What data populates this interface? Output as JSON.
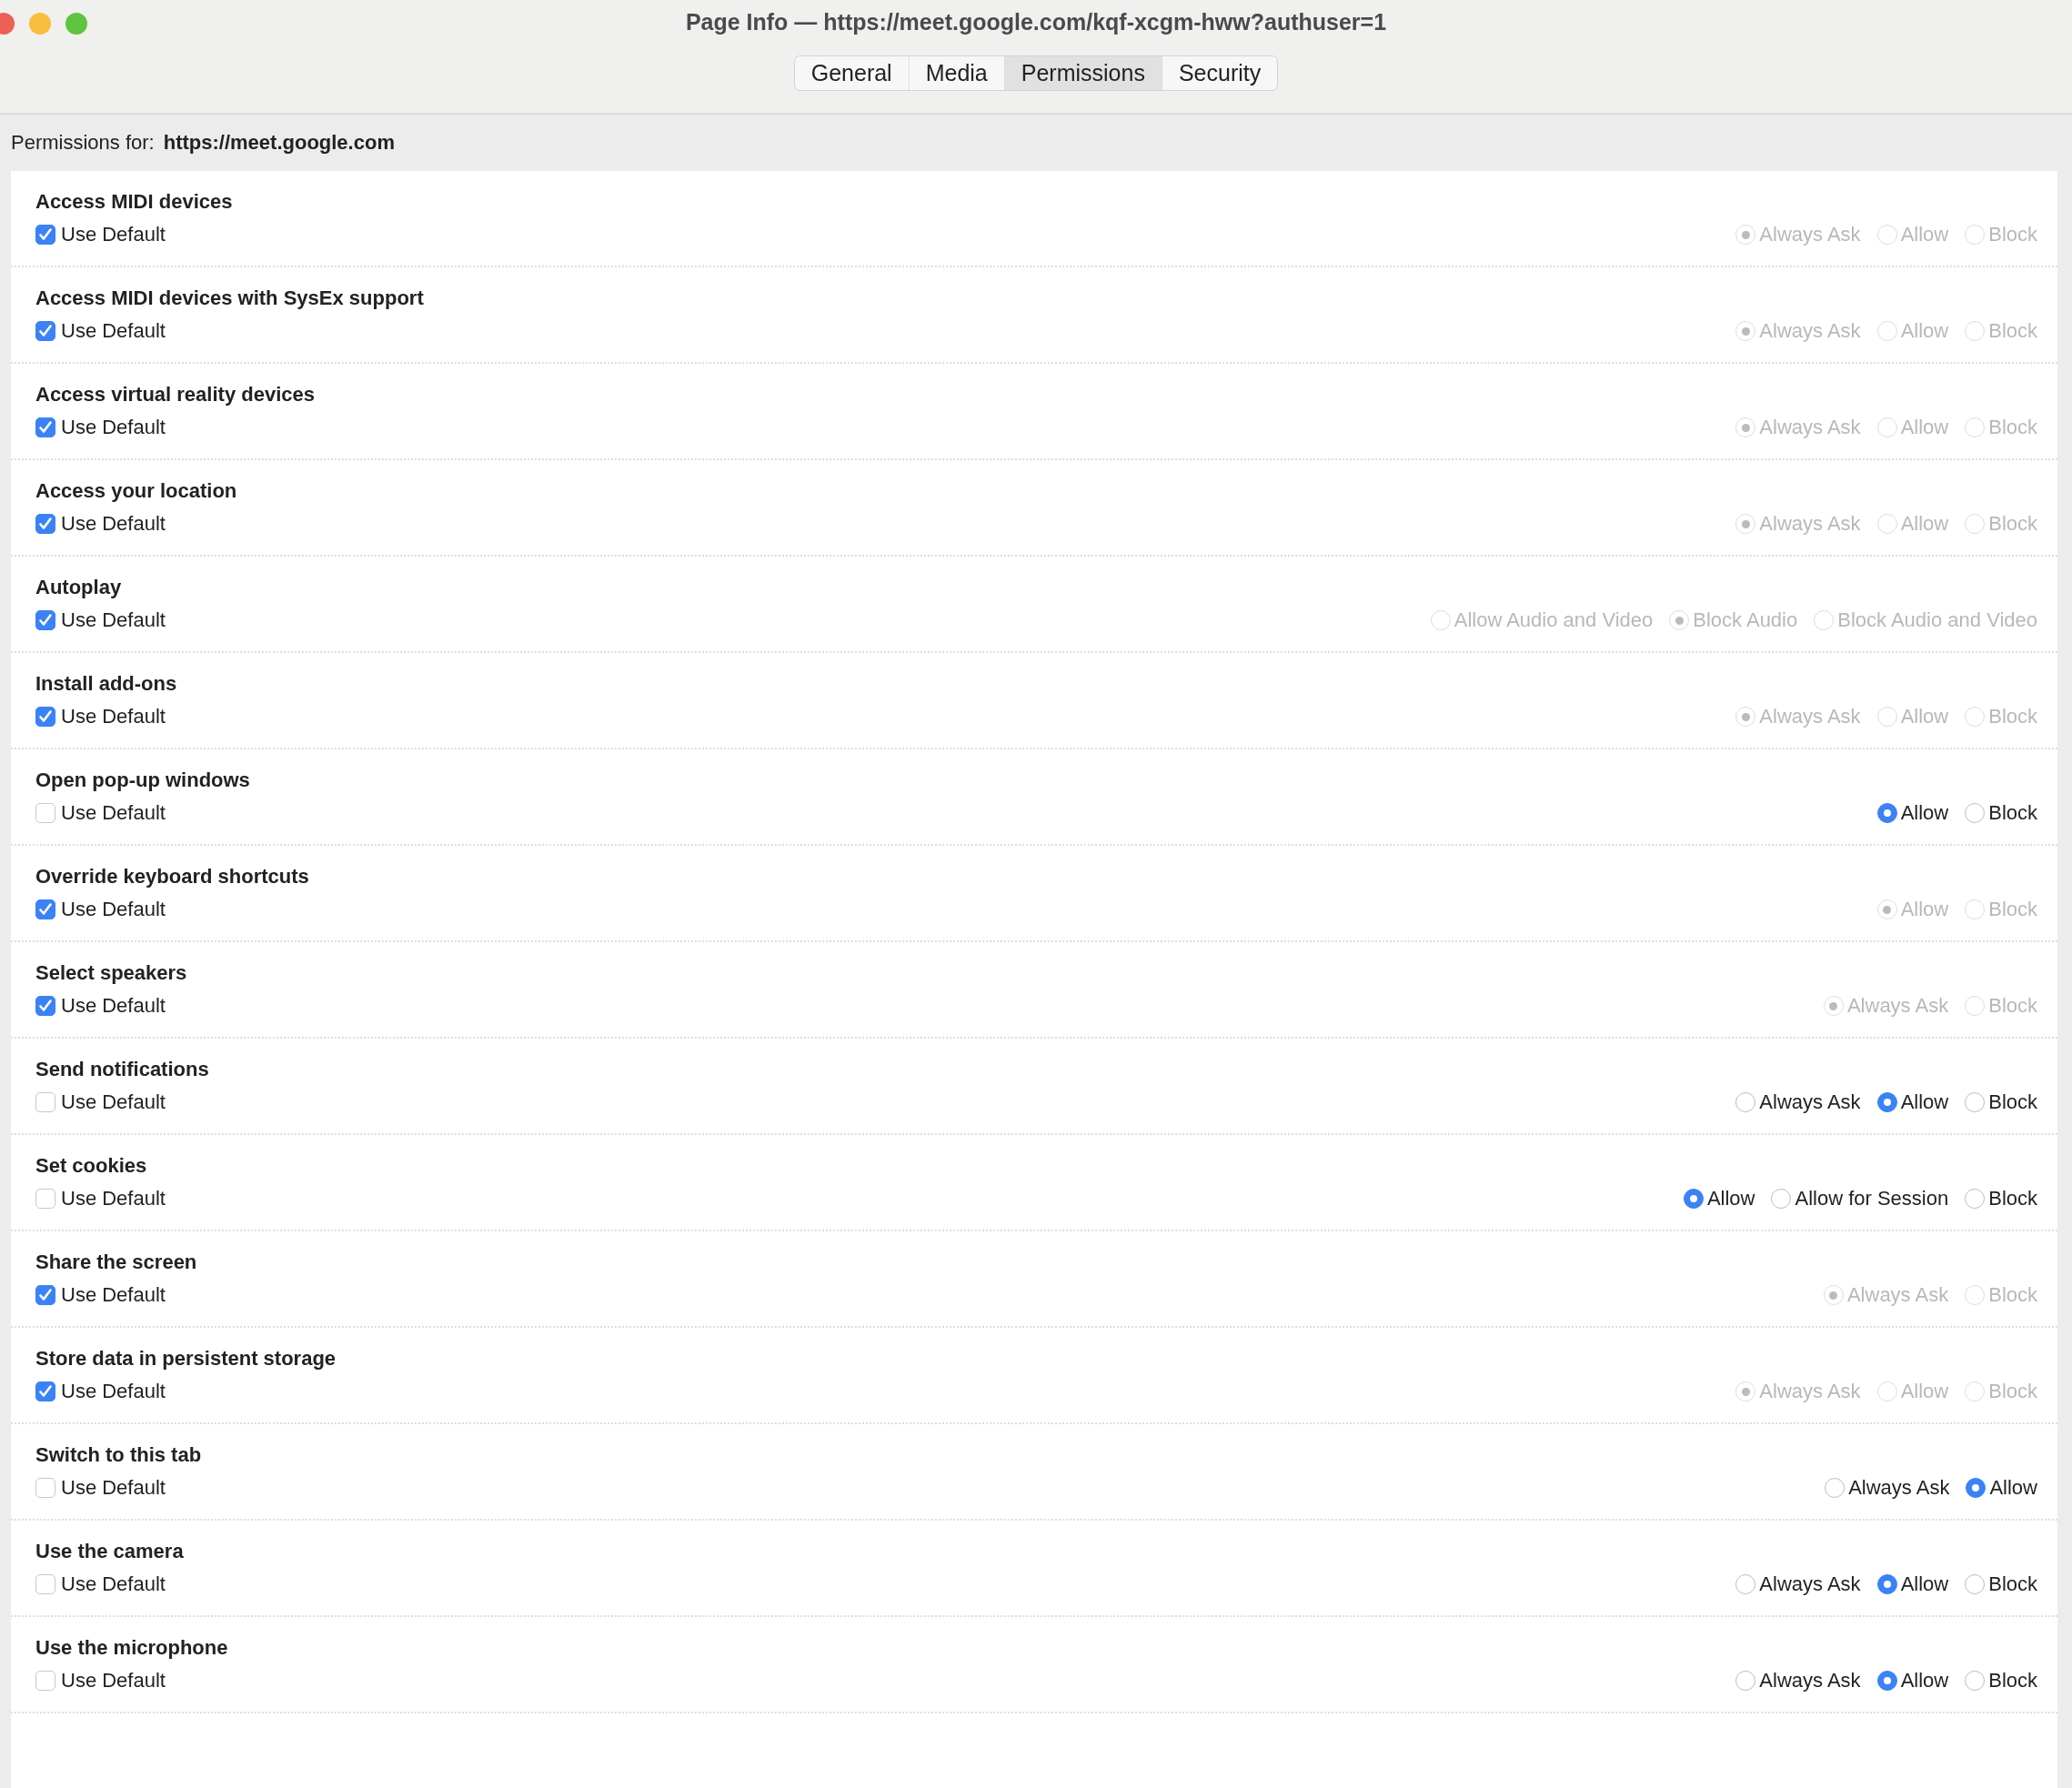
{
  "window": {
    "title": "Page Info — https://meet.google.com/kqf-xcgm-hww?authuser=1"
  },
  "tabs": [
    {
      "label": "General",
      "selected": false
    },
    {
      "label": "Media",
      "selected": false
    },
    {
      "label": "Permissions",
      "selected": true
    },
    {
      "label": "Security",
      "selected": false
    }
  ],
  "site": {
    "label": "Permissions for:",
    "value": "https://meet.google.com"
  },
  "permissions": [
    {
      "name": "Access MIDI devices",
      "use_default": {
        "label": "Use Default",
        "checked": true
      },
      "options": [
        {
          "label": "Always Ask",
          "selected": true
        },
        {
          "label": "Allow",
          "selected": false
        },
        {
          "label": "Block",
          "selected": false
        }
      ]
    },
    {
      "name": "Access MIDI devices with SysEx support",
      "use_default": {
        "label": "Use Default",
        "checked": true
      },
      "options": [
        {
          "label": "Always Ask",
          "selected": true
        },
        {
          "label": "Allow",
          "selected": false
        },
        {
          "label": "Block",
          "selected": false
        }
      ]
    },
    {
      "name": "Access virtual reality devices",
      "use_default": {
        "label": "Use Default",
        "checked": true
      },
      "options": [
        {
          "label": "Always Ask",
          "selected": true
        },
        {
          "label": "Allow",
          "selected": false
        },
        {
          "label": "Block",
          "selected": false
        }
      ]
    },
    {
      "name": "Access your location",
      "use_default": {
        "label": "Use Default",
        "checked": true
      },
      "options": [
        {
          "label": "Always Ask",
          "selected": true
        },
        {
          "label": "Allow",
          "selected": false
        },
        {
          "label": "Block",
          "selected": false
        }
      ]
    },
    {
      "name": "Autoplay",
      "use_default": {
        "label": "Use Default",
        "checked": true
      },
      "options": [
        {
          "label": "Allow Audio and Video",
          "selected": false
        },
        {
          "label": "Block Audio",
          "selected": true
        },
        {
          "label": "Block Audio and Video",
          "selected": false
        }
      ]
    },
    {
      "name": "Install add-ons",
      "use_default": {
        "label": "Use Default",
        "checked": true
      },
      "options": [
        {
          "label": "Always Ask",
          "selected": true
        },
        {
          "label": "Allow",
          "selected": false
        },
        {
          "label": "Block",
          "selected": false
        }
      ]
    },
    {
      "name": "Open pop-up windows",
      "use_default": {
        "label": "Use Default",
        "checked": false
      },
      "options": [
        {
          "label": "Allow",
          "selected": true
        },
        {
          "label": "Block",
          "selected": false
        }
      ]
    },
    {
      "name": "Override keyboard shortcuts",
      "use_default": {
        "label": "Use Default",
        "checked": true
      },
      "options": [
        {
          "label": "Allow",
          "selected": true
        },
        {
          "label": "Block",
          "selected": false
        }
      ]
    },
    {
      "name": "Select speakers",
      "use_default": {
        "label": "Use Default",
        "checked": true
      },
      "options": [
        {
          "label": "Always Ask",
          "selected": true
        },
        {
          "label": "Block",
          "selected": false
        }
      ]
    },
    {
      "name": "Send notifications",
      "use_default": {
        "label": "Use Default",
        "checked": false
      },
      "options": [
        {
          "label": "Always Ask",
          "selected": false
        },
        {
          "label": "Allow",
          "selected": true
        },
        {
          "label": "Block",
          "selected": false
        }
      ]
    },
    {
      "name": "Set cookies",
      "use_default": {
        "label": "Use Default",
        "checked": false
      },
      "options": [
        {
          "label": "Allow",
          "selected": true
        },
        {
          "label": "Allow for Session",
          "selected": false
        },
        {
          "label": "Block",
          "selected": false
        }
      ]
    },
    {
      "name": "Share the screen",
      "use_default": {
        "label": "Use Default",
        "checked": true
      },
      "options": [
        {
          "label": "Always Ask",
          "selected": true
        },
        {
          "label": "Block",
          "selected": false
        }
      ]
    },
    {
      "name": "Store data in persistent storage",
      "use_default": {
        "label": "Use Default",
        "checked": true
      },
      "options": [
        {
          "label": "Always Ask",
          "selected": true
        },
        {
          "label": "Allow",
          "selected": false
        },
        {
          "label": "Block",
          "selected": false
        }
      ]
    },
    {
      "name": "Switch to this tab",
      "use_default": {
        "label": "Use Default",
        "checked": false
      },
      "options": [
        {
          "label": "Always Ask",
          "selected": false
        },
        {
          "label": "Allow",
          "selected": true
        }
      ]
    },
    {
      "name": "Use the camera",
      "use_default": {
        "label": "Use Default",
        "checked": false
      },
      "options": [
        {
          "label": "Always Ask",
          "selected": false
        },
        {
          "label": "Allow",
          "selected": true
        },
        {
          "label": "Block",
          "selected": false
        }
      ]
    },
    {
      "name": "Use the microphone",
      "use_default": {
        "label": "Use Default",
        "checked": false
      },
      "options": [
        {
          "label": "Always Ask",
          "selected": false
        },
        {
          "label": "Allow",
          "selected": true
        },
        {
          "label": "Block",
          "selected": false
        }
      ]
    }
  ]
}
